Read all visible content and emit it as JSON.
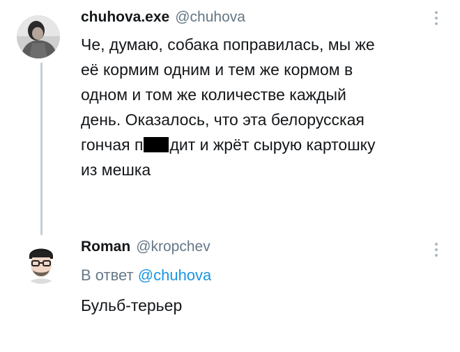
{
  "tweet": {
    "name": "chuhova.exe",
    "handle": "@chuhova",
    "lines": [
      "Че, думаю, собака поправилась, мы же",
      "её кормим одним и тем же кормом в",
      "одном и том же количестве каждый",
      "день. Оказалось, что эта белорусская"
    ],
    "line5_before": "гончая п",
    "line5_after": "дит и жрёт сырую картошку",
    "line6": "из мешка"
  },
  "reply": {
    "name": "Roman",
    "handle": "@kropchev",
    "reply_to_prefix": "В ответ",
    "reply_to_handle": "@chuhova",
    "text": "Бульб-терьер"
  },
  "icons": {
    "more_1": "more-vertical-icon",
    "more_2": "more-vertical-icon"
  },
  "colors": {
    "link": "#1b95e0",
    "muted": "#657786",
    "thread_line": "#c4cfd6"
  }
}
